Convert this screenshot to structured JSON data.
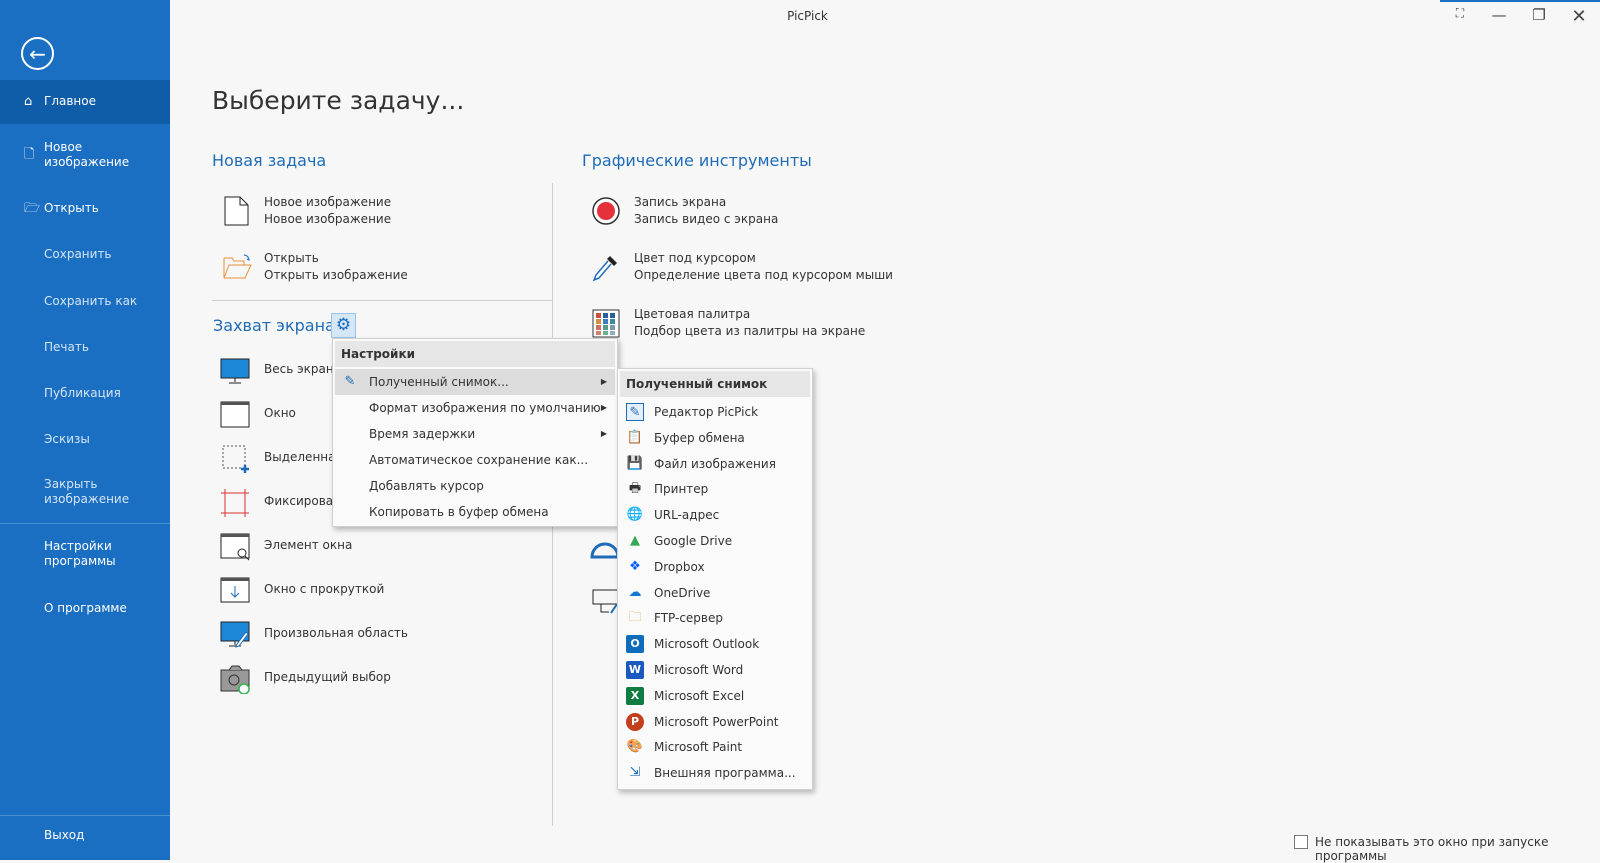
{
  "window": {
    "title": "PicPick"
  },
  "sidebar": {
    "items": [
      {
        "label": "Главное",
        "icon": "home-icon"
      },
      {
        "label": "Новое изображение",
        "icon": "file-icon"
      },
      {
        "label": "Открыть",
        "icon": "folder-open-icon"
      },
      {
        "label": "Сохранить"
      },
      {
        "label": "Сохранить как"
      },
      {
        "label": "Печать"
      },
      {
        "label": "Публикация"
      },
      {
        "label": "Эскизы"
      },
      {
        "label": "Закрыть изображение"
      },
      {
        "label": "Настройки программы"
      },
      {
        "label": "О программе"
      },
      {
        "label": "Выход"
      }
    ]
  },
  "main": {
    "title": "Выберите задачу...",
    "new_task": {
      "heading": "Новая задача",
      "items": [
        {
          "title": "Новое изображение",
          "desc": "Новое изображение"
        },
        {
          "title": "Открыть",
          "desc": "Открыть изображение"
        }
      ]
    },
    "capture": {
      "heading": "Захват экрана",
      "items": [
        "Весь экран",
        "Окно",
        "Выделенная",
        "Фиксирован",
        "Элемент окна",
        "Окно с прокруткой",
        "Произвольная область",
        "Предыдущий выбор"
      ]
    },
    "tools": {
      "heading": "Графические инструменты",
      "items": [
        {
          "title": "Запись экрана",
          "desc": "Запись видео с экрана"
        },
        {
          "title": "Цвет под курсором",
          "desc": "Определение цвета под курсором мыши"
        },
        {
          "title": "Цветовая палитра",
          "desc": "Подбор цвета из палитры на экране"
        }
      ]
    },
    "dont_show": "Не показывать это окно при запуске программы"
  },
  "settings_menu": {
    "header": "Настройки",
    "items": [
      {
        "label": "Полученный снимок...",
        "submenu": true,
        "selected": true
      },
      {
        "label": "Формат изображения по умолчанию",
        "submenu": true
      },
      {
        "label": "Время задержки",
        "submenu": true
      },
      {
        "label": "Автоматическое сохранение как..."
      },
      {
        "label": "Добавлять курсор"
      },
      {
        "label": "Копировать в буфер обмена"
      }
    ]
  },
  "output_menu": {
    "header": "Полученный снимок",
    "items": [
      {
        "label": "Редактор PicPick",
        "icon": "picpick-editor-icon",
        "color": "#1e6cb8",
        "checked": true
      },
      {
        "label": "Буфер обмена",
        "icon": "clipboard-icon",
        "color": "#e8a040"
      },
      {
        "label": "Файл изображения",
        "icon": "save-icon",
        "color": "#a64fc4"
      },
      {
        "label": "Принтер",
        "icon": "printer-icon",
        "color": "#333333"
      },
      {
        "label": "URL-адрес",
        "icon": "globe-icon",
        "color": "#333333"
      },
      {
        "label": "Google Drive",
        "icon": "google-drive-icon",
        "color": "#34a853"
      },
      {
        "label": "Dropbox",
        "icon": "dropbox-icon",
        "color": "#0061fe"
      },
      {
        "label": "OneDrive",
        "icon": "onedrive-icon",
        "color": "#0f78d4"
      },
      {
        "label": "FTP-сервер",
        "icon": "ftp-icon",
        "color": "#e8a040"
      },
      {
        "label": "Microsoft Outlook",
        "icon": "outlook-icon",
        "color": "#0f6cbd"
      },
      {
        "label": "Microsoft Word",
        "icon": "word-icon",
        "color": "#185abd"
      },
      {
        "label": "Microsoft Excel",
        "icon": "excel-icon",
        "color": "#107c41"
      },
      {
        "label": "Microsoft PowerPoint",
        "icon": "powerpoint-icon",
        "color": "#c43e1c"
      },
      {
        "label": "Microsoft Paint",
        "icon": "paint-icon",
        "color": "#3aa0d8"
      },
      {
        "label": "Внешняя программа...",
        "icon": "external-program-icon",
        "color": "#1e6cb8"
      }
    ]
  }
}
